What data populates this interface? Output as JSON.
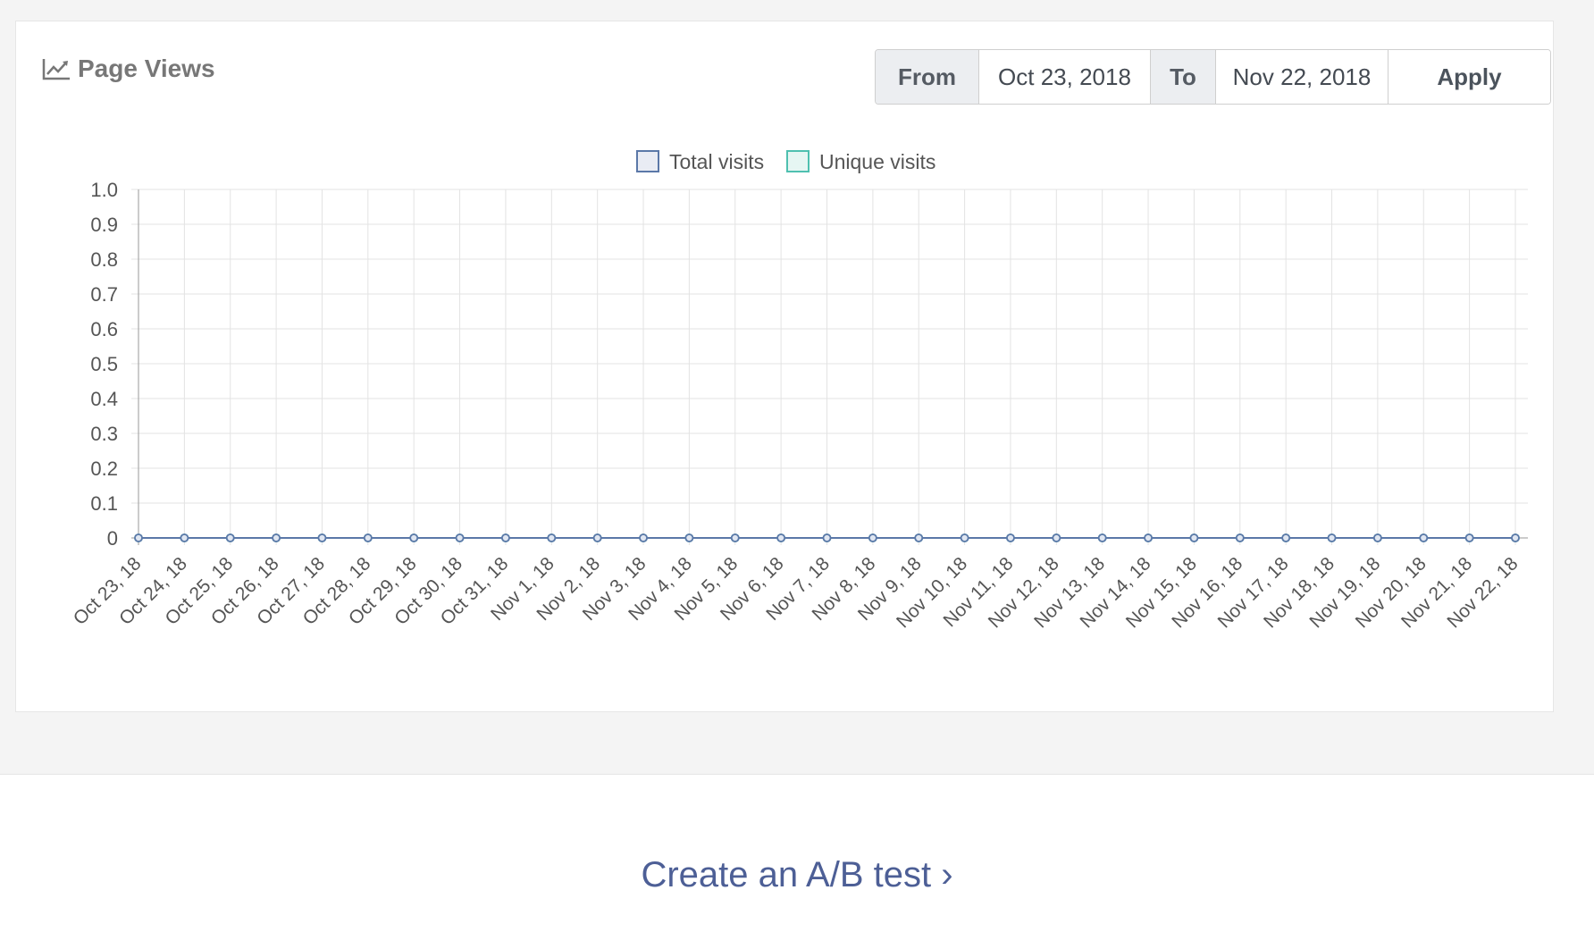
{
  "card": {
    "title": "Page Views",
    "title_icon": "line-chart-icon"
  },
  "date_range": {
    "from_label": "From",
    "from_value": "Oct 23, 2018",
    "to_label": "To",
    "to_value": "Nov 22, 2018",
    "apply_label": "Apply"
  },
  "colors": {
    "total_visits": "#5b78a8",
    "unique_visits": "#4fc0b0",
    "link": "#4d5f96"
  },
  "chart_data": {
    "type": "line",
    "title": "",
    "xlabel": "",
    "ylabel": "",
    "ylim": [
      0,
      1.0
    ],
    "yticks": [
      "1.0",
      "0.9",
      "0.8",
      "0.7",
      "0.6",
      "0.5",
      "0.4",
      "0.3",
      "0.2",
      "0.1",
      "0"
    ],
    "grid": true,
    "legend_position": "top-center",
    "x": [
      "Oct 23, 18",
      "Oct 24, 18",
      "Oct 25, 18",
      "Oct 26, 18",
      "Oct 27, 18",
      "Oct 28, 18",
      "Oct 29, 18",
      "Oct 30, 18",
      "Oct 31, 18",
      "Nov 1, 18",
      "Nov 2, 18",
      "Nov 3, 18",
      "Nov 4, 18",
      "Nov 5, 18",
      "Nov 6, 18",
      "Nov 7, 18",
      "Nov 8, 18",
      "Nov 9, 18",
      "Nov 10, 18",
      "Nov 11, 18",
      "Nov 12, 18",
      "Nov 13, 18",
      "Nov 14, 18",
      "Nov 15, 18",
      "Nov 16, 18",
      "Nov 17, 18",
      "Nov 18, 18",
      "Nov 19, 18",
      "Nov 20, 18",
      "Nov 21, 18",
      "Nov 22, 18"
    ],
    "series": [
      {
        "name": "Total visits",
        "values": [
          0,
          0,
          0,
          0,
          0,
          0,
          0,
          0,
          0,
          0,
          0,
          0,
          0,
          0,
          0,
          0,
          0,
          0,
          0,
          0,
          0,
          0,
          0,
          0,
          0,
          0,
          0,
          0,
          0,
          0,
          0
        ]
      },
      {
        "name": "Unique visits",
        "values": [
          0,
          0,
          0,
          0,
          0,
          0,
          0,
          0,
          0,
          0,
          0,
          0,
          0,
          0,
          0,
          0,
          0,
          0,
          0,
          0,
          0,
          0,
          0,
          0,
          0,
          0,
          0,
          0,
          0,
          0,
          0
        ]
      }
    ]
  },
  "footer": {
    "ab_test_link": "Create an A/B test ›"
  }
}
